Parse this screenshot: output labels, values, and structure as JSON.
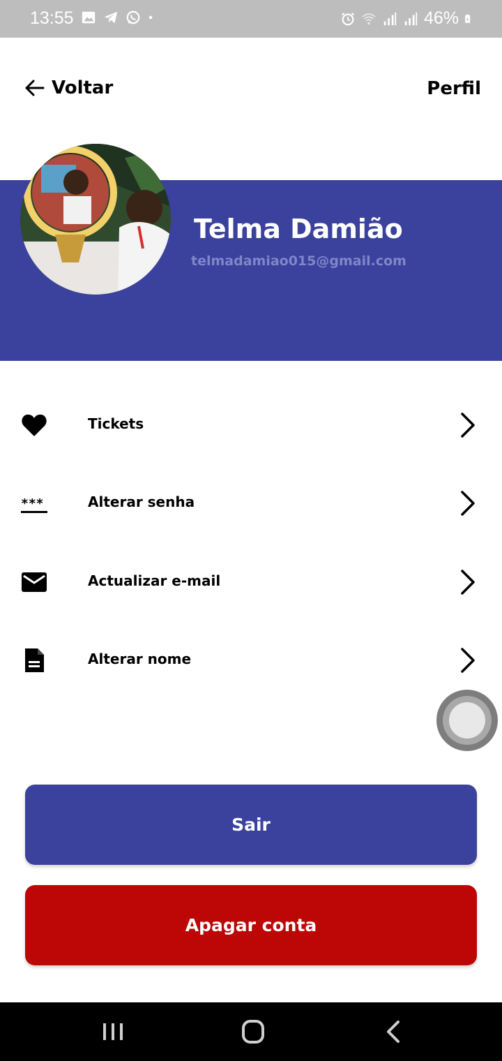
{
  "status_bar": {
    "time": "13:55",
    "left_icons": [
      "gallery-icon",
      "telegram-icon",
      "whatsapp-icon",
      "dot-icon"
    ],
    "right_icons": [
      "alarm-icon",
      "wifi-icon",
      "signal-icon",
      "signal-icon",
      "battery-charging-icon"
    ],
    "battery": "46%"
  },
  "header": {
    "back_label": "Voltar",
    "title": "Perfil"
  },
  "profile": {
    "name": "Telma Damião",
    "email": "telmadamiao015@gmail.com"
  },
  "menu": {
    "items": [
      {
        "label": "Tickets",
        "icon": "heart-icon"
      },
      {
        "label": "Alterar senha",
        "icon": "password-icon"
      },
      {
        "label": "Actualizar e-mail",
        "icon": "mail-icon"
      },
      {
        "label": "Alterar nome",
        "icon": "document-icon"
      }
    ]
  },
  "actions": {
    "logout_label": "Sair",
    "delete_label": "Apagar conta"
  },
  "colors": {
    "primary": "#3b429d",
    "danger": "#bd0606",
    "email_text": "#7f86c9"
  },
  "nav_bar": {
    "buttons": [
      "recent-apps-icon",
      "home-icon",
      "back-nav-icon"
    ]
  }
}
